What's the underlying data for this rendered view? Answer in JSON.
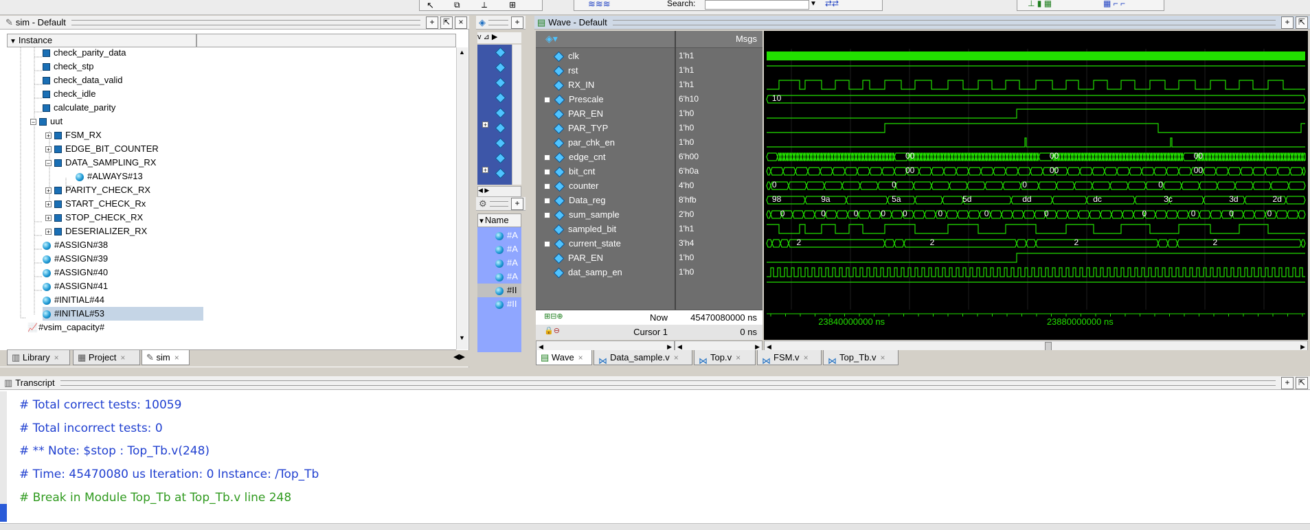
{
  "toolbar": {
    "search_label": "Search:"
  },
  "sim_panel": {
    "title": "sim - Default",
    "column_header": "Instance",
    "items": [
      {
        "label": "check_parity_data"
      },
      {
        "label": "check_stp"
      },
      {
        "label": "check_data_valid"
      },
      {
        "label": "check_idle"
      },
      {
        "label": "calculate_parity"
      },
      {
        "label": "uut"
      },
      {
        "label": "FSM_RX"
      },
      {
        "label": "EDGE_BIT_COUNTER"
      },
      {
        "label": "DATA_SAMPLING_RX"
      },
      {
        "label": "#ALWAYS#13"
      },
      {
        "label": "PARITY_CHECK_RX"
      },
      {
        "label": "START_CHECK_Rx"
      },
      {
        "label": "STOP_CHECK_RX"
      },
      {
        "label": "DESERIALIZER_RX"
      },
      {
        "label": "#ASSIGN#38"
      },
      {
        "label": "#ASSIGN#39"
      },
      {
        "label": "#ASSIGN#40"
      },
      {
        "label": "#ASSIGN#41"
      },
      {
        "label": "#INITIAL#44"
      },
      {
        "label": "#INITIAL#53"
      },
      {
        "label": "#vsim_capacity#"
      }
    ],
    "tabs": [
      "Library",
      "Project",
      "sim"
    ]
  },
  "objects_panel": {
    "column_header": "Name",
    "items": [
      "#A",
      "#A",
      "#A",
      "#A",
      "#II",
      "#II"
    ]
  },
  "wave_panel": {
    "title": "Wave - Default",
    "msgs_header": "Msgs",
    "signals": [
      {
        "name": "clk",
        "value": "1'h1"
      },
      {
        "name": "rst",
        "value": "1'h1"
      },
      {
        "name": "RX_IN",
        "value": "1'h1"
      },
      {
        "name": "Prescale",
        "value": "6'h10"
      },
      {
        "name": "PAR_EN",
        "value": "1'h0"
      },
      {
        "name": "PAR_TYP",
        "value": "1'h0"
      },
      {
        "name": "par_chk_en",
        "value": "1'h0"
      },
      {
        "name": "edge_cnt",
        "value": "6'h00"
      },
      {
        "name": "bit_cnt",
        "value": "6'h0a"
      },
      {
        "name": "counter",
        "value": "4'h0"
      },
      {
        "name": "Data_reg",
        "value": "8'hfb"
      },
      {
        "name": "sum_sample",
        "value": "2'h0"
      },
      {
        "name": "sampled_bit",
        "value": "1'h1"
      },
      {
        "name": "current_state",
        "value": "3'h4"
      },
      {
        "name": "PAR_EN",
        "value": "1'h0"
      },
      {
        "name": "dat_samp_en",
        "value": "1'h0"
      }
    ],
    "bus_labels": [
      {
        "row": 3,
        "text": "10",
        "x": 0.01
      },
      {
        "row": 7,
        "text": "00",
        "x": 0.255
      },
      {
        "row": 7,
        "text": "00",
        "x": 0.52
      },
      {
        "row": 7,
        "text": "00",
        "x": 0.785
      },
      {
        "row": 8,
        "text": "00",
        "x": 0.255
      },
      {
        "row": 8,
        "text": "00",
        "x": 0.52
      },
      {
        "row": 8,
        "text": "00",
        "x": 0.785
      },
      {
        "row": 9,
        "text": "0",
        "x": 0.01
      },
      {
        "row": 9,
        "text": "0",
        "x": 0.23
      },
      {
        "row": 9,
        "text": "0",
        "x": 0.47
      },
      {
        "row": 9,
        "text": "0",
        "x": 0.72
      },
      {
        "row": 10,
        "text": "98",
        "x": 0.01
      },
      {
        "row": 10,
        "text": "9a",
        "x": 0.1
      },
      {
        "row": 10,
        "text": "5a",
        "x": 0.23
      },
      {
        "row": 10,
        "text": "5d",
        "x": 0.36
      },
      {
        "row": 10,
        "text": "dd",
        "x": 0.47
      },
      {
        "row": 10,
        "text": "dc",
        "x": 0.6
      },
      {
        "row": 10,
        "text": "3c",
        "x": 0.73
      },
      {
        "row": 10,
        "text": "3d",
        "x": 0.85
      },
      {
        "row": 10,
        "text": "2d",
        "x": 0.93
      },
      {
        "row": 11,
        "text": "0",
        "x": 0.025
      },
      {
        "row": 11,
        "text": "0",
        "x": 0.1
      },
      {
        "row": 11,
        "text": "0",
        "x": 0.16
      },
      {
        "row": 11,
        "text": "0",
        "x": 0.21
      },
      {
        "row": 11,
        "text": "0",
        "x": 0.25
      },
      {
        "row": 11,
        "text": "0",
        "x": 0.315
      },
      {
        "row": 11,
        "text": "0",
        "x": 0.4
      },
      {
        "row": 11,
        "text": "0",
        "x": 0.51
      },
      {
        "row": 11,
        "text": "0",
        "x": 0.69
      },
      {
        "row": 11,
        "text": "0",
        "x": 0.78
      },
      {
        "row": 11,
        "text": "0",
        "x": 0.85
      },
      {
        "row": 11,
        "text": "0",
        "x": 0.92
      },
      {
        "row": 13,
        "text": "2",
        "x": 0.055
      },
      {
        "row": 13,
        "text": "2",
        "x": 0.3
      },
      {
        "row": 13,
        "text": "2",
        "x": 0.565
      },
      {
        "row": 13,
        "text": "2",
        "x": 0.82
      }
    ],
    "now_label": "Now",
    "now_value": "45470080000 ns",
    "cursor_label": "Cursor 1",
    "cursor_value": "0 ns",
    "time_ticks": [
      {
        "label": "23840000000 ns",
        "x": 0.1
      },
      {
        "label": "23880000000 ns",
        "x": 0.52
      }
    ],
    "tabs": [
      "Wave",
      "Data_sample.v",
      "Top.v",
      "FSM.v",
      "Top_Tb.v"
    ]
  },
  "transcript": {
    "title": "Transcript",
    "lines": [
      {
        "text": "# Total correct tests:      10059",
        "color": "#1f3fd0"
      },
      {
        "text": "# Total incorrect tests:         0",
        "color": "#1f3fd0"
      },
      {
        "text": "# ** Note: $stop    : Top_Tb.v(248)",
        "color": "#1f3fd0"
      },
      {
        "text": "#    Time: 45470080 us  Iteration: 0  Instance: /Top_Tb",
        "color": "#1f3fd0"
      },
      {
        "text": "# Break in Module Top_Tb at Top_Tb.v line 248",
        "color": "#2f9a1e"
      }
    ]
  },
  "colors": {
    "wave_green": "#22e000",
    "wave_bg": "#000000",
    "names_bg": "#6e6e6e"
  }
}
